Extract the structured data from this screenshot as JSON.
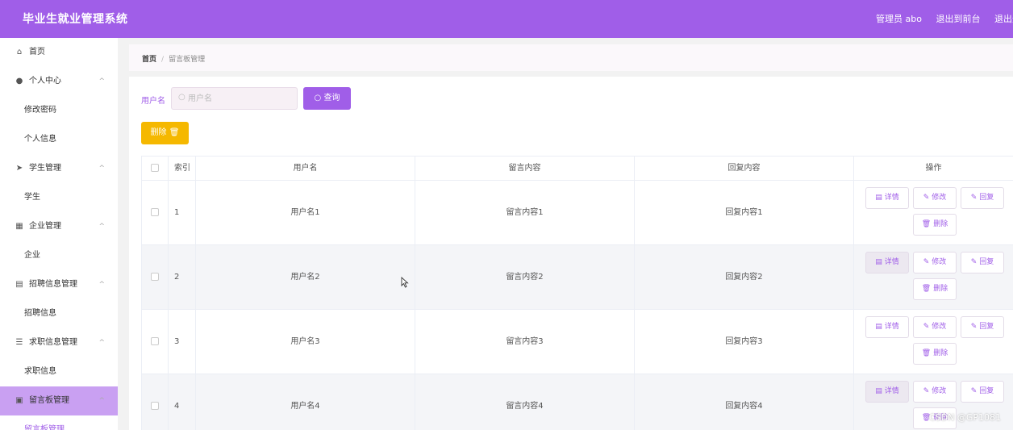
{
  "app": {
    "title": "毕业生就业管理系统",
    "admin_label": "管理员 abo",
    "front_link": "退出到前台",
    "logout_link": "退出登录"
  },
  "sidebar": {
    "items": [
      {
        "label": "首页",
        "icon": "home-icon",
        "glyph": "⌂"
      },
      {
        "label": "个人中心",
        "icon": "user-icon",
        "glyph": "●"
      },
      {
        "label": "修改密码"
      },
      {
        "label": "个人信息"
      },
      {
        "label": "学生管理",
        "icon": "send-icon",
        "glyph": "➤"
      },
      {
        "label": "学生"
      },
      {
        "label": "企业管理",
        "icon": "grid-icon",
        "glyph": "▦"
      },
      {
        "label": "企业"
      },
      {
        "label": "招聘信息管理",
        "icon": "document-icon",
        "glyph": "▤"
      },
      {
        "label": "招聘信息"
      },
      {
        "label": "求职信息管理",
        "icon": "list-icon",
        "glyph": "☰"
      },
      {
        "label": "求职信息"
      },
      {
        "label": "留言板管理",
        "icon": "message-icon",
        "glyph": "▣"
      },
      {
        "label": "留言板管理"
      }
    ],
    "chevron": "^"
  },
  "breadcrumb": {
    "home": "首页",
    "separator": "/",
    "current": "留言板管理"
  },
  "search": {
    "label": "用户名",
    "placeholder": "用户名",
    "value": "",
    "query_button": "查询"
  },
  "actions": {
    "delete_button": "删除"
  },
  "table": {
    "headers": {
      "index": "索引",
      "username": "用户名",
      "message": "留言内容",
      "reply": "回复内容",
      "ops": "操作"
    },
    "rows": [
      {
        "index": "1",
        "username": "用户名1",
        "message": "留言内容1",
        "reply": "回复内容1"
      },
      {
        "index": "2",
        "username": "用户名2",
        "message": "留言内容2",
        "reply": "回复内容2"
      },
      {
        "index": "3",
        "username": "用户名3",
        "message": "留言内容3",
        "reply": "回复内容3"
      },
      {
        "index": "4",
        "username": "用户名4",
        "message": "留言内容4",
        "reply": "回复内容4"
      }
    ],
    "row_actions": {
      "detail": "详情",
      "edit": "修改",
      "reply": "回复",
      "delete": "删除"
    }
  },
  "watermark": "CSDN @GP1081",
  "colors": {
    "accent": "#a05ee8",
    "warning": "#f5b800",
    "sidebar_active": "#c9a0f2"
  }
}
